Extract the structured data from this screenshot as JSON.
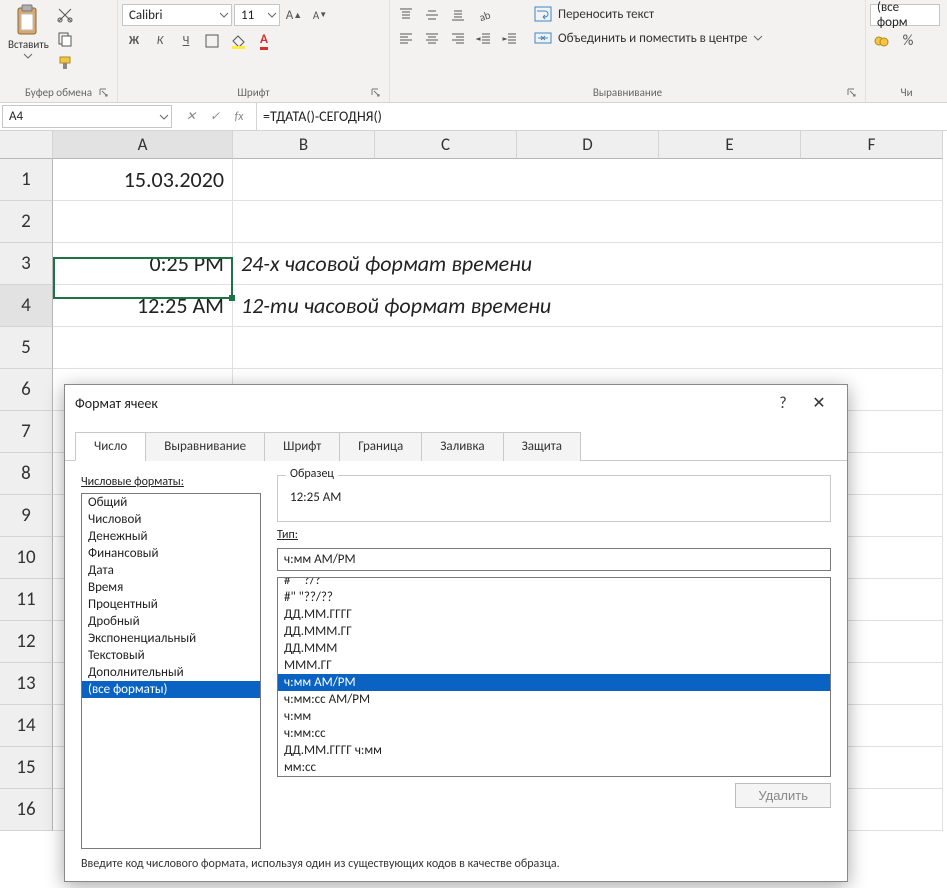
{
  "ribbon": {
    "clipboard": {
      "paste": "Вставить",
      "caption": "Буфер обмена"
    },
    "font": {
      "name": "Calibri",
      "size": "11",
      "bold": "Ж",
      "italic": "К",
      "underline": "Ч",
      "caption": "Шрифт"
    },
    "align": {
      "wrap": "Переносить текст",
      "merge": "Объединить и поместить в центре",
      "caption": "Выравнивание"
    },
    "number": {
      "format_current": "(все форм",
      "percent": "%",
      "caption": "Чи"
    }
  },
  "formula_bar": {
    "name_box": "A4",
    "cancel": "✕",
    "enter": "✓",
    "fx": "fx",
    "formula": "=ТДАТА()-СЕГОДНЯ()"
  },
  "grid": {
    "columns": [
      "A",
      "B",
      "C",
      "D",
      "E",
      "F"
    ],
    "rows": [
      {
        "n": "1",
        "A": "15.03.2020",
        "rest": ""
      },
      {
        "n": "2",
        "A": "",
        "rest": ""
      },
      {
        "n": "3",
        "A": "0:25 PM",
        "rest": "24-х часовой формат времени"
      },
      {
        "n": "4",
        "A": "12:25 AM",
        "rest": "12-ти часовой формат времени"
      },
      {
        "n": "5",
        "A": "",
        "rest": ""
      },
      {
        "n": "6",
        "A": "",
        "rest": ""
      },
      {
        "n": "7",
        "A": "",
        "rest": ""
      },
      {
        "n": "8",
        "A": "",
        "rest": ""
      },
      {
        "n": "9",
        "A": "",
        "rest": ""
      },
      {
        "n": "10",
        "A": "",
        "rest": ""
      },
      {
        "n": "11",
        "A": "",
        "rest": ""
      },
      {
        "n": "12",
        "A": "",
        "rest": ""
      },
      {
        "n": "13",
        "A": "",
        "rest": ""
      },
      {
        "n": "14",
        "A": "",
        "rest": ""
      },
      {
        "n": "15",
        "A": "",
        "rest": ""
      },
      {
        "n": "16",
        "A": "",
        "rest": ""
      }
    ]
  },
  "dialog": {
    "title": "Формат ячеек",
    "help": "?",
    "close": "✕",
    "tabs": [
      "Число",
      "Выравнивание",
      "Шрифт",
      "Граница",
      "Заливка",
      "Защита"
    ],
    "active_tab": 0,
    "categories_label": "Числовые форматы:",
    "categories": [
      "Общий",
      "Числовой",
      "Денежный",
      "Финансовый",
      "Дата",
      "Время",
      "Процентный",
      "Дробный",
      "Экспоненциальный",
      "Текстовый",
      "Дополнительный",
      "(все форматы)"
    ],
    "categories_selected": 11,
    "sample_label": "Образец",
    "sample_value": "12:25 AM",
    "type_label": "Тип:",
    "type_value": "ч:мм AM/PM",
    "type_list": [
      "#\" \"?/?",
      "#\" \"??/??",
      "ДД.ММ.ГГГГ",
      "ДД.МММ.ГГ",
      "ДД.МММ",
      "МММ.ГГ",
      "ч:мм AM/PM",
      "ч:мм:cc AM/PM",
      "ч:мм",
      "ч:мм:cc",
      "ДД.ММ.ГГГГ ч:мм",
      "мм:cc"
    ],
    "type_selected": 6,
    "delete": "Удалить",
    "hint": "Введите код числового формата, используя один из существующих кодов в качестве образца."
  }
}
